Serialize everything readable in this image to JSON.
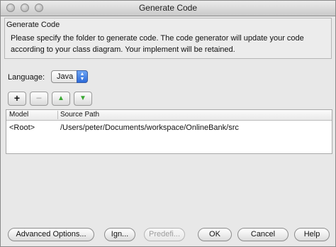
{
  "window": {
    "title": "Generate Code"
  },
  "group": {
    "title": "Generate Code",
    "description": "Please specify the folder to generate code. The code generator will update your code according to your class diagram. Your implement will be retained."
  },
  "language": {
    "label": "Language:",
    "value": "Java"
  },
  "toolbar": {
    "add": "+",
    "remove": "−",
    "up": "▲",
    "down": "▼"
  },
  "table": {
    "columns": [
      "Model",
      "Source Path"
    ],
    "rows": [
      {
        "model": "<Root>",
        "path": "/Users/peter/Documents/workspace/OnlineBank/src"
      }
    ]
  },
  "buttons": {
    "advanced": "Advanced Options...",
    "ign": "Ign...",
    "predefi": "Predefi...",
    "ok": "OK",
    "cancel": "Cancel",
    "help": "Help"
  },
  "colors": {
    "accent_blue": "#2c6ad9",
    "toolbar_green": "#3aa833"
  }
}
